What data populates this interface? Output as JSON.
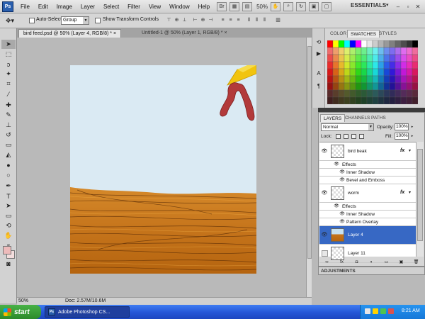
{
  "app": {
    "logo_text": "Ps",
    "menu": [
      "File",
      "Edit",
      "Image",
      "Layer",
      "Select",
      "Filter",
      "View",
      "Window",
      "Help"
    ],
    "zoom_display": "50%",
    "workspace": "ESSENTIALS"
  },
  "options_bar": {
    "auto_select_label": "Auto-Select:",
    "auto_select_value": "Group",
    "show_transform_label": "Show Transform Controls"
  },
  "documents": {
    "tabs": [
      {
        "title": "bird feed.psd @ 50% (Layer 4, RGB/8) *",
        "close": "×",
        "active": true
      },
      {
        "title": "Untitled-1 @ 50% (Layer 1, RGB/8) *",
        "close": "×",
        "active": false
      }
    ]
  },
  "status_bar": {
    "zoom": "50%",
    "doc_info": "Doc: 2.57M/10.6M"
  },
  "colors": {
    "foreground": "#eebbbb",
    "background": "#f3dddd",
    "selection": "#3768c4",
    "sky": "#daeaf3",
    "wood": "#c5741b"
  },
  "swatches_panel": {
    "tabs": [
      "COLOR",
      "SWATCHES",
      "STYLES"
    ],
    "active_tab": "SWATCHES"
  },
  "layers_panel": {
    "tabs": [
      "LAYERS",
      "CHANNELS",
      "PATHS"
    ],
    "active_tab": "LAYERS",
    "blend_mode": "Normal",
    "opacity_label": "Opacity:",
    "opacity_value": "100%",
    "lock_label": "Lock:",
    "fill_label": "Fill:",
    "fill_value": "100%",
    "rows": [
      {
        "type": "layer",
        "name": "bird beak",
        "visible": true,
        "fx": "fx",
        "selected": false
      },
      {
        "type": "effects",
        "name": "Effects"
      },
      {
        "type": "effect",
        "name": "Inner Shadow"
      },
      {
        "type": "effect",
        "name": "Bevel and Emboss"
      },
      {
        "type": "layer",
        "name": "worm",
        "visible": true,
        "fx": "fx",
        "selected": false
      },
      {
        "type": "effects",
        "name": "Effects"
      },
      {
        "type": "effect",
        "name": "Inner Shadow"
      },
      {
        "type": "effect",
        "name": "Pattern Overlay"
      },
      {
        "type": "layer",
        "name": "Layer 4",
        "visible": true,
        "selected": true
      },
      {
        "type": "layer",
        "name": "Layer 11",
        "visible": false,
        "selected": false
      }
    ]
  },
  "adjustments_panel": {
    "title": "ADJUSTMENTS"
  },
  "taskbar": {
    "start_label": "start",
    "app_button": "Adobe Photoshop CS...",
    "clock": "8:21 AM"
  }
}
